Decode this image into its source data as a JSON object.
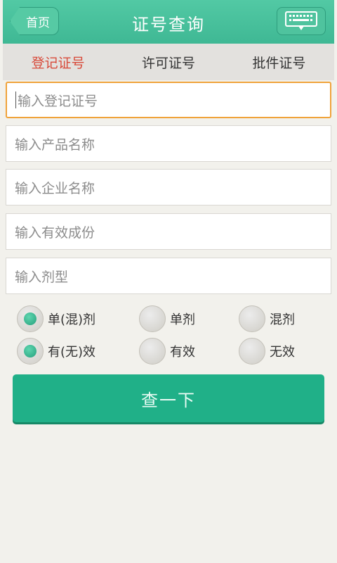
{
  "header": {
    "home_label": "首页",
    "title": "证号查询",
    "keyboard_icon": "keyboard-icon"
  },
  "tabs": [
    {
      "label": "登记证号",
      "active": true
    },
    {
      "label": "许可证号",
      "active": false
    },
    {
      "label": "批件证号",
      "active": false
    }
  ],
  "fields": [
    {
      "placeholder": "输入登记证号",
      "focused": true
    },
    {
      "placeholder": "输入产品名称",
      "focused": false
    },
    {
      "placeholder": "输入企业名称",
      "focused": false
    },
    {
      "placeholder": "输入有效成份",
      "focused": false
    },
    {
      "placeholder": "输入剂型",
      "focused": false
    }
  ],
  "radio_groups": [
    {
      "options": [
        {
          "label": "单(混)剂",
          "selected": true
        },
        {
          "label": "单剂",
          "selected": false
        },
        {
          "label": "混剂",
          "selected": false
        }
      ]
    },
    {
      "options": [
        {
          "label": "有(无)效",
          "selected": true
        },
        {
          "label": "有效",
          "selected": false
        },
        {
          "label": "无效",
          "selected": false
        }
      ]
    }
  ],
  "query_button": {
    "label": "查一下"
  },
  "colors": {
    "header": "#45be99",
    "active_tab": "#d84a3a",
    "button": "#20b088",
    "focus_border": "#f0a33a"
  }
}
